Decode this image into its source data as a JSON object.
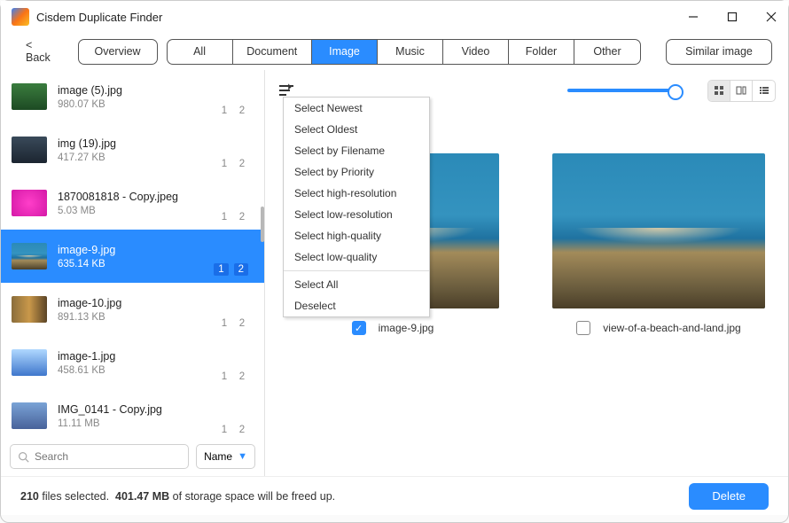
{
  "app": {
    "title": "Cisdem Duplicate Finder"
  },
  "toolbar": {
    "back": "< Back",
    "overview": "Overview",
    "tabs": [
      "All",
      "Document",
      "Image",
      "Music",
      "Video",
      "Folder",
      "Other"
    ],
    "active_tab": 2,
    "similar": "Similar image"
  },
  "files": [
    {
      "name": "image (5).jpg",
      "size": "980.07 KB",
      "thumb": "jungle",
      "b1": "1",
      "b2": "2",
      "selected": false
    },
    {
      "name": "img (19).jpg",
      "size": "417.27 KB",
      "thumb": "dark",
      "b1": "1",
      "b2": "2",
      "selected": false
    },
    {
      "name": "1870081818 - Copy.jpeg",
      "size": "5.03 MB",
      "thumb": "pink",
      "b1": "1",
      "b2": "2",
      "selected": false
    },
    {
      "name": "image-9.jpg",
      "size": "635.14 KB",
      "thumb": "beach",
      "b1": "1",
      "b2": "2",
      "selected": true
    },
    {
      "name": "image-10.jpg",
      "size": "891.13 KB",
      "thumb": "autumn",
      "b1": "1",
      "b2": "2",
      "selected": false
    },
    {
      "name": "image-1.jpg",
      "size": "458.61 KB",
      "thumb": "blu",
      "b1": "1",
      "b2": "2",
      "selected": false
    },
    {
      "name": "IMG_0141 - Copy.jpg",
      "size": "11.11 MB",
      "thumb": "fld",
      "b1": "1",
      "b2": "2",
      "selected": false
    }
  ],
  "search": {
    "placeholder": "Search",
    "sort": "Name"
  },
  "menu": {
    "group1": [
      "Select Newest",
      "Select Oldest",
      "Select by Filename",
      "Select by Priority",
      "Select high-resolution",
      "Select low-resolution",
      "Select high-quality",
      "Select low-quality"
    ],
    "group2": [
      "Select All",
      "Deselect"
    ]
  },
  "preview": {
    "items": [
      {
        "name": "image-9.jpg",
        "checked": true,
        "thumb": "beach"
      },
      {
        "name": "view-of-a-beach-and-land.jpg",
        "checked": false,
        "thumb": "beach"
      }
    ]
  },
  "status": {
    "count": "210",
    "unit": "files selected.",
    "size": "401.47 MB",
    "rest": "of storage space will be freed up.",
    "delete": "Delete"
  }
}
